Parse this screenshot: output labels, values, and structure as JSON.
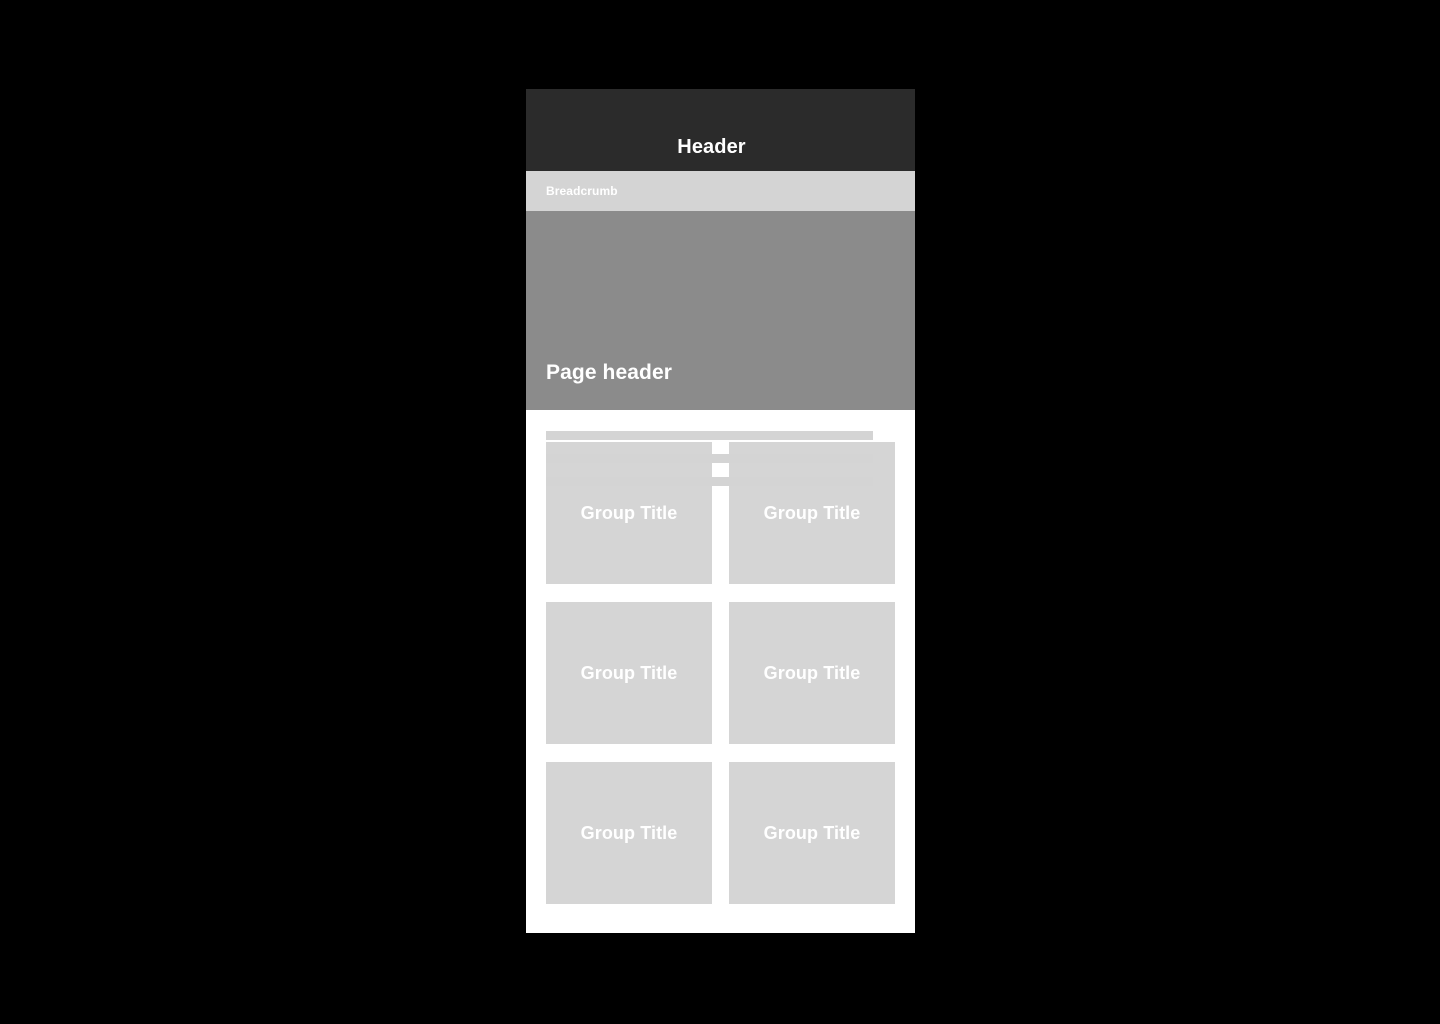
{
  "frame": {
    "background_color": "#ffffff",
    "page_background_color": "#000000"
  },
  "header": {
    "title": "Header",
    "background_color": "#2b2b2b",
    "text_color": "#ffffff"
  },
  "breadcrumb": {
    "label": "Breadcrumb",
    "background_color": "#d4d4d4",
    "text_color": "#ffffff"
  },
  "page_header": {
    "title": "Page header",
    "background_color": "#8b8b8b",
    "text_color": "#ffffff",
    "placeholder_bars": [
      {
        "id": "bar-1"
      },
      {
        "id": "bar-2"
      },
      {
        "id": "bar-3"
      }
    ],
    "placeholder_bar_color": "#d4d4d4"
  },
  "content": {
    "card_background_color": "#d5d5d5",
    "card_text_color": "#ffffff",
    "cards": [
      {
        "title": "Group Title"
      },
      {
        "title": "Group Title"
      },
      {
        "title": "Group Title"
      },
      {
        "title": "Group Title"
      },
      {
        "title": "Group Title"
      },
      {
        "title": "Group Title"
      }
    ]
  }
}
